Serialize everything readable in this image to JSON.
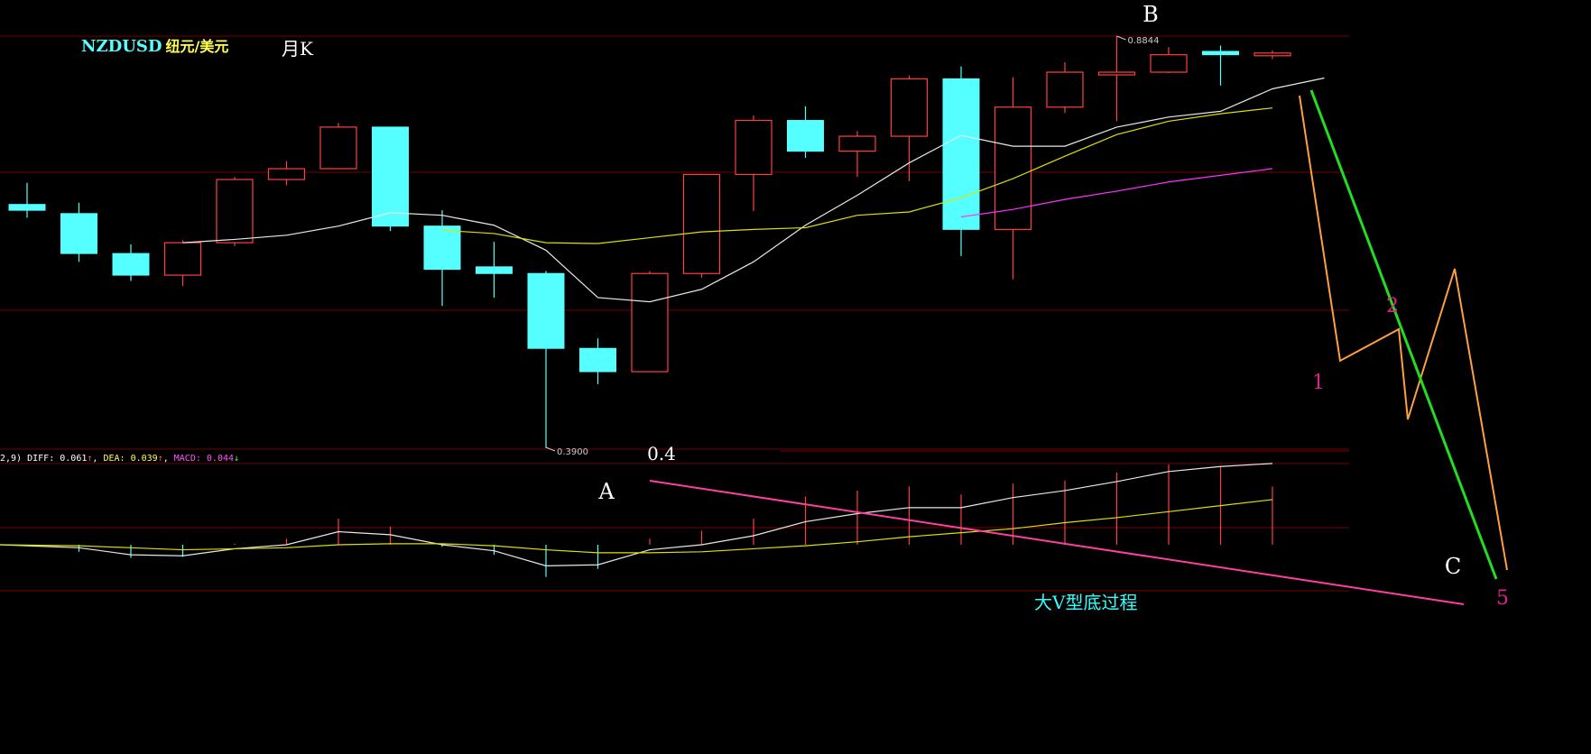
{
  "header": {
    "symbol": "NZDUSD",
    "pair_name": "纽元/美元",
    "period": "月K"
  },
  "macd_info": {
    "params": "2,9)",
    "diff_label": "DIFF:",
    "diff_value": "0.061",
    "dea_label": "DEA:",
    "dea_value": "0.039",
    "macd_label": "MACD:",
    "macd_value": "0.044",
    "up_arrow": "↑",
    "down_arrow": "↓"
  },
  "colors": {
    "up": "#ff4040",
    "down": "#55ffff",
    "ma_fast": "#e8e8e8",
    "ma_mid": "#e0e000",
    "ma_slow": "#ff33ff",
    "grid": "#7a0000",
    "wave_orange": "#ffa040",
    "wave_green": "#22dd22",
    "annot_magenta": "#ff2ea0",
    "trend_magenta": "#ff3fa0",
    "text_cyan": "#33ffff"
  },
  "chart_data": {
    "type": "candlestick",
    "price_ylim": [
      0.35,
      0.9
    ],
    "candles": [
      {
        "o": 0.682,
        "h": 0.708,
        "l": 0.666,
        "c": 0.675
      },
      {
        "o": 0.671,
        "h": 0.684,
        "l": 0.613,
        "c": 0.623
      },
      {
        "o": 0.623,
        "h": 0.634,
        "l": 0.59,
        "c": 0.597
      },
      {
        "o": 0.597,
        "h": 0.639,
        "l": 0.584,
        "c": 0.636
      },
      {
        "o": 0.636,
        "h": 0.715,
        "l": 0.632,
        "c": 0.712
      },
      {
        "o": 0.712,
        "h": 0.734,
        "l": 0.705,
        "c": 0.725
      },
      {
        "o": 0.725,
        "h": 0.78,
        "l": 0.725,
        "c": 0.775
      },
      {
        "o": 0.775,
        "h": 0.775,
        "l": 0.65,
        "c": 0.656
      },
      {
        "o": 0.656,
        "h": 0.675,
        "l": 0.56,
        "c": 0.604
      },
      {
        "o": 0.607,
        "h": 0.637,
        "l": 0.57,
        "c": 0.599
      },
      {
        "o": 0.599,
        "h": 0.602,
        "l": 0.389,
        "c": 0.509
      },
      {
        "o": 0.509,
        "h": 0.521,
        "l": 0.466,
        "c": 0.481
      },
      {
        "o": 0.481,
        "h": 0.602,
        "l": 0.481,
        "c": 0.599
      },
      {
        "o": 0.599,
        "h": 0.719,
        "l": 0.594,
        "c": 0.718
      },
      {
        "o": 0.718,
        "h": 0.789,
        "l": 0.674,
        "c": 0.783
      },
      {
        "o": 0.783,
        "h": 0.8,
        "l": 0.738,
        "c": 0.746
      },
      {
        "o": 0.746,
        "h": 0.77,
        "l": 0.715,
        "c": 0.764
      },
      {
        "o": 0.764,
        "h": 0.837,
        "l": 0.71,
        "c": 0.833
      },
      {
        "o": 0.833,
        "h": 0.848,
        "l": 0.62,
        "c": 0.652
      },
      {
        "o": 0.652,
        "h": 0.835,
        "l": 0.592,
        "c": 0.799
      },
      {
        "o": 0.799,
        "h": 0.853,
        "l": 0.792,
        "c": 0.841
      },
      {
        "o": 0.841,
        "h": 0.8844,
        "l": 0.782,
        "c": 0.841
      },
      {
        "o": 0.841,
        "h": 0.871,
        "l": 0.84,
        "c": 0.862
      },
      {
        "o": 0.866,
        "h": 0.873,
        "l": 0.825,
        "c": 0.862
      },
      {
        "o": 0.862,
        "h": 0.867,
        "l": 0.857,
        "c": 0.864
      }
    ],
    "ma_fast": [
      null,
      null,
      null,
      0.636,
      0.64,
      0.645,
      0.656,
      0.672,
      0.669,
      0.657,
      0.627,
      0.57,
      0.565,
      0.58,
      0.613,
      0.657,
      0.693,
      0.732,
      0.765,
      0.752,
      0.752,
      0.775,
      0.787,
      0.794,
      0.821,
      0.834
    ],
    "ma_mid": [
      null,
      null,
      null,
      null,
      null,
      null,
      null,
      null,
      0.651,
      0.647,
      0.636,
      0.635,
      0.642,
      0.649,
      0.652,
      0.654,
      0.669,
      0.673,
      0.69,
      0.713,
      0.74,
      0.766,
      0.782,
      0.791,
      0.798
    ],
    "ma_slow": [
      null,
      null,
      null,
      null,
      null,
      null,
      null,
      null,
      null,
      null,
      null,
      null,
      null,
      null,
      null,
      null,
      null,
      null,
      0.667,
      0.676,
      0.688,
      0.698,
      0.709,
      0.717,
      0.725
    ],
    "price_labels": {
      "high": "0.8844",
      "low": "0.3900"
    },
    "macd_ylim": [
      -0.05,
      0.1
    ],
    "diff": [
      0.0,
      -0.003,
      -0.01,
      -0.011,
      -0.004,
      0.0,
      0.013,
      0.01,
      0.0,
      -0.006,
      -0.021,
      -0.02,
      -0.005,
      0.0,
      0.009,
      0.023,
      0.031,
      0.037,
      0.037,
      0.047,
      0.054,
      0.063,
      0.073,
      0.078,
      0.081
    ],
    "dea": [
      0.0,
      -0.001,
      -0.003,
      -0.005,
      -0.004,
      -0.003,
      0.0,
      0.001,
      0.001,
      -0.001,
      -0.005,
      -0.008,
      -0.008,
      -0.007,
      -0.004,
      -0.001,
      0.003,
      0.008,
      0.012,
      0.016,
      0.022,
      0.027,
      0.033,
      0.039,
      0.045
    ],
    "hist": [
      0.0,
      -0.007,
      -0.013,
      -0.012,
      0.001,
      0.006,
      0.026,
      0.018,
      -0.002,
      -0.01,
      -0.032,
      -0.024,
      0.006,
      0.014,
      0.026,
      0.048,
      0.054,
      0.058,
      0.05,
      0.061,
      0.064,
      0.072,
      0.08,
      0.078,
      0.058
    ],
    "annotations": {
      "point_a": "A",
      "point_b": "B",
      "point_c": "C",
      "fib_level": "0.4",
      "wave_1": "1",
      "wave_2": "2",
      "wave_5": "5",
      "caption": "大V型底过程"
    }
  }
}
